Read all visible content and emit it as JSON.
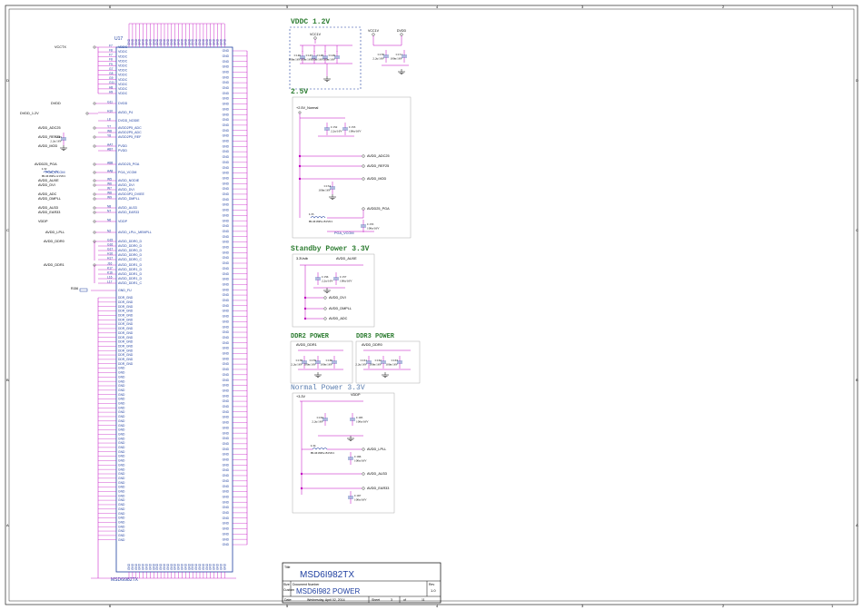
{
  "border": {
    "cols": [
      "6",
      "5",
      "4",
      "3",
      "2",
      "1"
    ],
    "rows": [
      "D",
      "C",
      "B",
      "A"
    ]
  },
  "ic": {
    "ref": "U17",
    "part": "MSD6I982TX",
    "left_pins": [
      {
        "num": "F7",
        "name": "VDDC"
      },
      {
        "num": "F8",
        "name": "VDDC"
      },
      {
        "num": "F7",
        "name": "VDDC"
      },
      {
        "num": "F8",
        "name": "VDDC"
      },
      {
        "num": "F9",
        "name": "VDDC"
      },
      {
        "num": "G7",
        "name": "VDDC"
      },
      {
        "num": "G8",
        "name": "VDDC"
      },
      {
        "num": "G9",
        "name": "VDDC"
      },
      {
        "num": "G11",
        "name": "VDDC"
      },
      {
        "num": "H8",
        "name": "VDDC"
      },
      {
        "num": "H9",
        "name": "VDDC"
      }
    ],
    "left_groups": [
      {
        "num": "G11",
        "name": "DVDD"
      },
      {
        "num": "H10",
        "name": "AVDD_P4"
      },
      {
        "num": "L8",
        "name": "DVDD_NODIE"
      },
      {
        "num": "Y7",
        "name": "AVDD2P5_ADC"
      },
      {
        "num": "W8",
        "name": "AVDD2P5_ADC"
      },
      {
        "num": "Y8",
        "name": "AVDD2P5_REF"
      },
      {
        "num": "AA7",
        "name": "PVDD"
      },
      {
        "num": "AB7",
        "name": "PVDD"
      },
      {
        "num": "AB8",
        "name": "AVDD25_PGA"
      },
      {
        "num": "AA8",
        "name": "PGA_VCOM"
      },
      {
        "num": "W5",
        "name": "AVDD_NODIE"
      },
      {
        "num": "W6",
        "name": "AVDD_DVI"
      },
      {
        "num": "W7",
        "name": "AVDD_DVI"
      },
      {
        "num": "W8",
        "name": "AVDD3P3_DVIEE"
      },
      {
        "num": "W9",
        "name": "AVDD_DMPLL"
      },
      {
        "num": "N8",
        "name": "AVDD_AU33"
      },
      {
        "num": "N7",
        "name": "AVDD_EAR33"
      },
      {
        "num": "N6",
        "name": "VDDP"
      },
      {
        "num": "N2",
        "name": "AVDD_LPLL_MEMPLL"
      },
      {
        "num": "G15",
        "name": "AVDD_DDR0_D"
      },
      {
        "num": "G16",
        "name": "AVDD_DDR0_D"
      },
      {
        "num": "G17",
        "name": "AVDD_DDR0_D"
      },
      {
        "num": "H16",
        "name": "AVDD_DDR0_D"
      },
      {
        "num": "H17",
        "name": "AVDD_DDR0_C"
      },
      {
        "num": "J16",
        "name": "AVDD_DDR1_D"
      },
      {
        "num": "K17",
        "name": "AVDD_DDR1_D"
      },
      {
        "num": "K16",
        "name": "AVDD_DDR1_D"
      },
      {
        "num": "L16",
        "name": "AVDD_DDR1_D"
      },
      {
        "num": "L17",
        "name": "AVDD_DDR1_C"
      }
    ],
    "gnd_fu": "GND_FU",
    "ddr_gnd_label": "DDR_GND",
    "gnd_label": "GND",
    "left_net_labels": [
      "VCCTX",
      "DVDD",
      "DVDD_1.2V",
      "AVDD_ADC25",
      "AVDD_REF25",
      "AVDD_MOD",
      "AVDD25_PGA",
      "PGA_VCOM",
      "AVDD_AUXE",
      "AVDD_DVI",
      "AVDD_ADC",
      "AVDD_DMPLL",
      "AVDD_AU33",
      "AVDD_EAR33",
      "VDDP",
      "AVDD_LPLL",
      "AVDD_DDR0",
      "AVDD_DDR1"
    ],
    "left_parts": [
      {
        "ref": "C145",
        "val": "2.2u/16V"
      },
      {
        "ref": "L32",
        "val": "BLM18PG121SN1"
      },
      {
        "ref": "R156",
        "val": "0R"
      }
    ]
  },
  "sections": {
    "vddc": {
      "title": "VDDC 1.2V",
      "net1": "VCC1V",
      "net2": "VCC1V",
      "net3": "DVDD",
      "caps": [
        {
          "ref": "C146",
          "val": "100n/16V"
        },
        {
          "ref": "C147",
          "val": "100n/16V"
        },
        {
          "ref": "C148",
          "val": "100n/16V"
        },
        {
          "ref": "C149",
          "val": "100n/16V"
        },
        {
          "ref": "C150",
          "val": "2.2u/16V"
        },
        {
          "ref": "C151",
          "val": "100n/16V"
        }
      ]
    },
    "v25": {
      "title": "2.5V",
      "net_in": "+2.5V_Normal",
      "outs": [
        "AVDD_ADC25",
        "AVDD_REF25",
        "AVDD_MOD",
        "AVDD25_PGA",
        "PGA_VCOM"
      ],
      "caps": [
        {
          "ref": "C152",
          "val": "2.2u/16V"
        },
        {
          "ref": "C153",
          "val": "100n/16V"
        },
        {
          "ref": "C154",
          "val": "100n/16V"
        },
        {
          "ref": "C155",
          "val": "100n/16V"
        }
      ],
      "bead": {
        "ref": "L33",
        "val": "BLM18PG181SN1"
      }
    },
    "standby": {
      "title": "Standby Power 3.3V",
      "net_in": "3.3Vstb",
      "outs": [
        "AVDD_AUXE",
        "AVDD_DVI",
        "AVDD_DMPLL",
        "AVDD_ADC"
      ],
      "caps": [
        {
          "ref": "C156",
          "val": "2.2u/16V"
        },
        {
          "ref": "C157",
          "val": "100n/16V"
        }
      ]
    },
    "ddr2": {
      "title": "DDR2 POWER",
      "net": "AVDD_DDR1",
      "caps": [
        {
          "ref": "C158",
          "val": "2.2u/16V"
        },
        {
          "ref": "C159",
          "val": "100n/16V"
        },
        {
          "ref": "C160",
          "val": "100n/16V"
        }
      ]
    },
    "ddr3": {
      "title": "DDR3 POWER",
      "net": "AVDD_DDR0",
      "caps": [
        {
          "ref": "C161",
          "val": "2.2u/16V"
        },
        {
          "ref": "C162",
          "val": "100n/16V"
        },
        {
          "ref": "C163",
          "val": "100n/16V"
        }
      ]
    },
    "normal": {
      "title": "Normal Power 3.3V",
      "net_in": "+3.3V",
      "net_vddp": "VDDP",
      "outs": [
        "AVDD_LPLL",
        "AVDD_AU33",
        "AVDD_EAR33"
      ],
      "caps": [
        {
          "ref": "C164",
          "val": "2.2u/16V"
        },
        {
          "ref": "C165",
          "val": "100n/16V"
        },
        {
          "ref": "C166",
          "val": "100n/16V"
        },
        {
          "ref": "C167",
          "val": "100n/16V"
        }
      ],
      "bead": {
        "ref": "L34",
        "val": "BLM18PG181SN1"
      }
    }
  },
  "title_block": {
    "title_label": "Title",
    "title": "MSD6I982TX",
    "size_label": "Size",
    "size": "Custom",
    "docnum_label": "Document Number",
    "docnum": "MSD6I982 POWER",
    "rev_label": "Rev",
    "rev": "1.0",
    "date_label": "Date:",
    "date": "Wednesday, April 02, 2014",
    "sheet_label": "Sheet",
    "sheet": "3",
    "of_label": "of",
    "of": "11"
  },
  "colors": {
    "wire": "#c000c0",
    "part": "#1f3fa0",
    "net": "#000000",
    "title_green": "#2e7d32",
    "title_blue": "#1f3fa0"
  }
}
